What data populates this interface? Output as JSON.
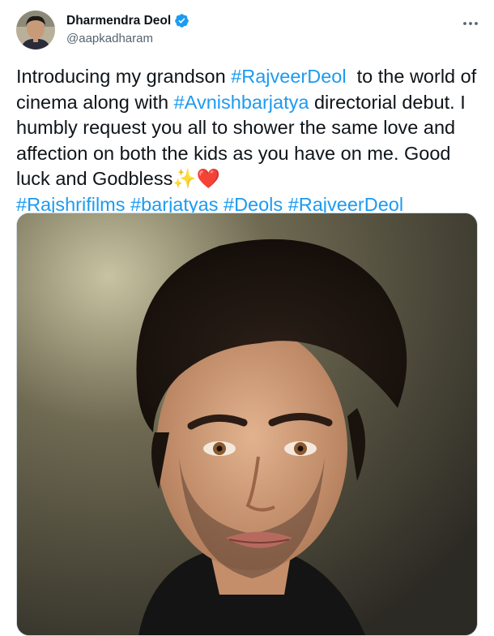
{
  "author": {
    "name": "Dharmendra Deol",
    "handle": "@aapkadharam"
  },
  "tweet": {
    "p1": "Introducing my grandson ",
    "tag1": "#RajveerDeol",
    "p2": "  to the world of cinema along with ",
    "tag2": "#Avnishbarjatya",
    "p3": " directorial debut. I humbly request you all to shower the same love and affection on both the kids as you have on me. Good luck and Godbless",
    "emoji_sparkles": "✨",
    "emoji_heart": "❤️",
    "tag3": "#Rajshrifilms",
    "tag4": "#barjatyas",
    "tag5": "#Deols",
    "tag6": "#RajveerDeol"
  },
  "icons": {
    "verified": "verified-badge-icon",
    "more": "more-options-icon"
  },
  "colors": {
    "link": "#1d9bf0",
    "verified": "#1d9bf0",
    "secondary_text": "#536471"
  }
}
